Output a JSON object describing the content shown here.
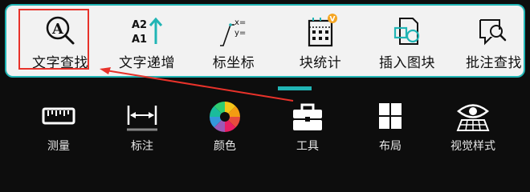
{
  "panel": {
    "items": [
      {
        "label": "文字查找",
        "icon": "text-search-icon",
        "active": true
      },
      {
        "label": "文字递增",
        "icon": "text-increment-icon",
        "ico_text_top": "A2",
        "ico_text_bottom": "A1"
      },
      {
        "label": "标坐标",
        "icon": "coordinate-label-icon",
        "ico_text_top": "x=",
        "ico_text_bottom": "y="
      },
      {
        "label": "块统计",
        "icon": "block-stats-icon",
        "badge": "V"
      },
      {
        "label": "插入图块",
        "icon": "insert-block-icon"
      },
      {
        "label": "批注查找",
        "icon": "annotation-search-icon"
      }
    ],
    "search_glyph": "A"
  },
  "toolbar": {
    "items": [
      {
        "label": "测量",
        "icon": "ruler-icon"
      },
      {
        "label": "标注",
        "icon": "dimension-icon"
      },
      {
        "label": "颜色",
        "icon": "color-wheel-icon"
      },
      {
        "label": "工具",
        "icon": "toolbox-icon"
      },
      {
        "label": "布局",
        "icon": "layout-grid-icon"
      },
      {
        "label": "视觉样式",
        "icon": "visual-style-icon"
      }
    ]
  },
  "colors": {
    "accent": "#21b5b5",
    "highlight": "#e8322a",
    "badge": "#f5a623",
    "panel_bg": "#f2f2f2",
    "toolbar_bg": "#0d0d0d"
  }
}
